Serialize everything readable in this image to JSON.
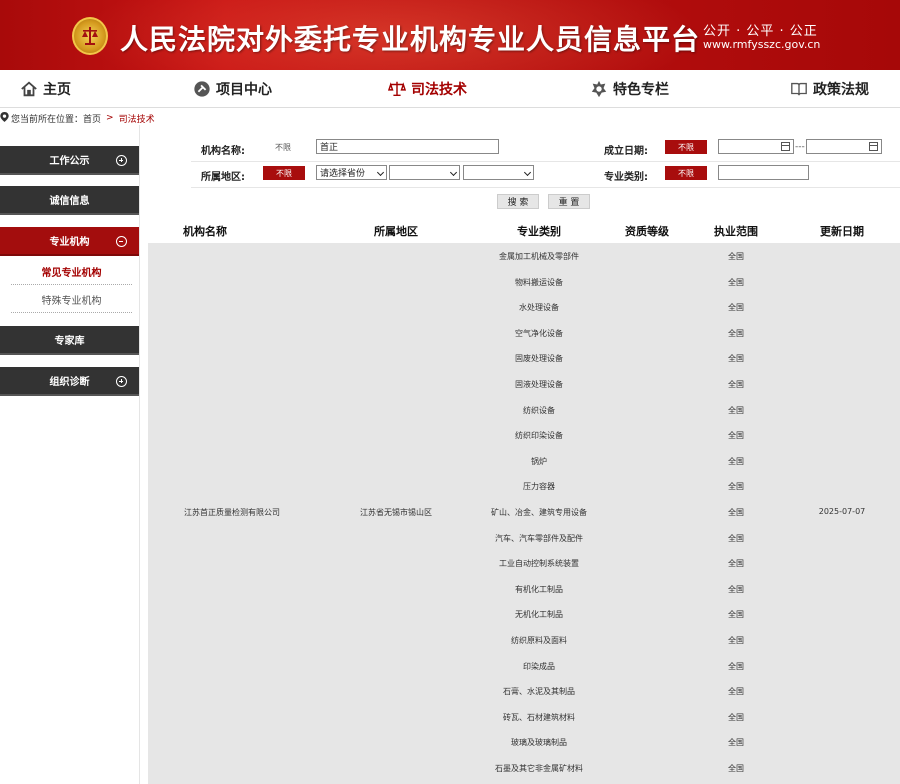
{
  "header": {
    "title": "人民法院对外委托专业机构专业人员信息平台",
    "slogan": "公开 · 公平 · 公正",
    "url": "www.rmfysszc.gov.cn"
  },
  "nav": [
    {
      "label": "主页",
      "icon": "home-icon"
    },
    {
      "label": "项目中心",
      "icon": "gavel-icon"
    },
    {
      "label": "司法技术",
      "icon": "scales-icon",
      "active": true
    },
    {
      "label": "特色专栏",
      "icon": "badge-icon"
    },
    {
      "label": "政策法规",
      "icon": "book-icon"
    }
  ],
  "breadcrumb": {
    "prefix": "您当前所在位置：",
    "home": "首页",
    "sep": ">",
    "current": "司法技术"
  },
  "sidebar": {
    "work_notice": "工作公示",
    "credit_info": "诚信信息",
    "pro_org": "专业机构",
    "common_org": "常见专业机构",
    "special_org": "特殊专业机构",
    "expert_lib": "专家库",
    "org_diag": "组织诊断"
  },
  "form": {
    "org_name_label": "机构名称:",
    "org_name_tag": "不限",
    "org_name_value": "首正",
    "founded_label": "成立日期:",
    "founded_tag": "不限",
    "date_dash": "---",
    "region_label": "所属地区:",
    "region_tag": "不限",
    "province_placeholder": "请选择省份",
    "category_label": "专业类别:",
    "category_tag": "不限",
    "search_btn": "搜 索",
    "reset_btn": "重 置"
  },
  "table": {
    "headers": [
      "机构名称",
      "所属地区",
      "专业类别",
      "资质等级",
      "执业范围",
      "更新日期"
    ],
    "org_name": "江苏首正质量检测有限公司",
    "region": "江苏省无锡市锡山区",
    "update_date": "2025-07-07",
    "rows": [
      {
        "category": "金属加工机械及零部件",
        "scope": "全国"
      },
      {
        "category": "物料搬运设备",
        "scope": "全国"
      },
      {
        "category": "水处理设备",
        "scope": "全国"
      },
      {
        "category": "空气净化设备",
        "scope": "全国"
      },
      {
        "category": "固废处理设备",
        "scope": "全国"
      },
      {
        "category": "固液处理设备",
        "scope": "全国"
      },
      {
        "category": "纺织设备",
        "scope": "全国"
      },
      {
        "category": "纺织印染设备",
        "scope": "全国"
      },
      {
        "category": "锅炉",
        "scope": "全国"
      },
      {
        "category": "压力容器",
        "scope": "全国"
      },
      {
        "category": "矿山、冶金、建筑专用设备",
        "scope": "全国"
      },
      {
        "category": "汽车、汽车零部件及配件",
        "scope": "全国"
      },
      {
        "category": "工业自动控制系统装置",
        "scope": "全国"
      },
      {
        "category": "有机化工制品",
        "scope": "全国"
      },
      {
        "category": "无机化工制品",
        "scope": "全国"
      },
      {
        "category": "纺织原料及面料",
        "scope": "全国"
      },
      {
        "category": "印染成品",
        "scope": "全国"
      },
      {
        "category": "石膏、水泥及其制品",
        "scope": "全国"
      },
      {
        "category": "砖瓦、石材建筑材料",
        "scope": "全国"
      },
      {
        "category": "玻璃及玻璃制品",
        "scope": "全国"
      },
      {
        "category": "石墨及其它非金属矿材料",
        "scope": "全国"
      }
    ]
  },
  "colors": {
    "brand_red": "#a80d0d",
    "sidebar_dark": "#333333",
    "table_bg": "#e6e6e6"
  }
}
